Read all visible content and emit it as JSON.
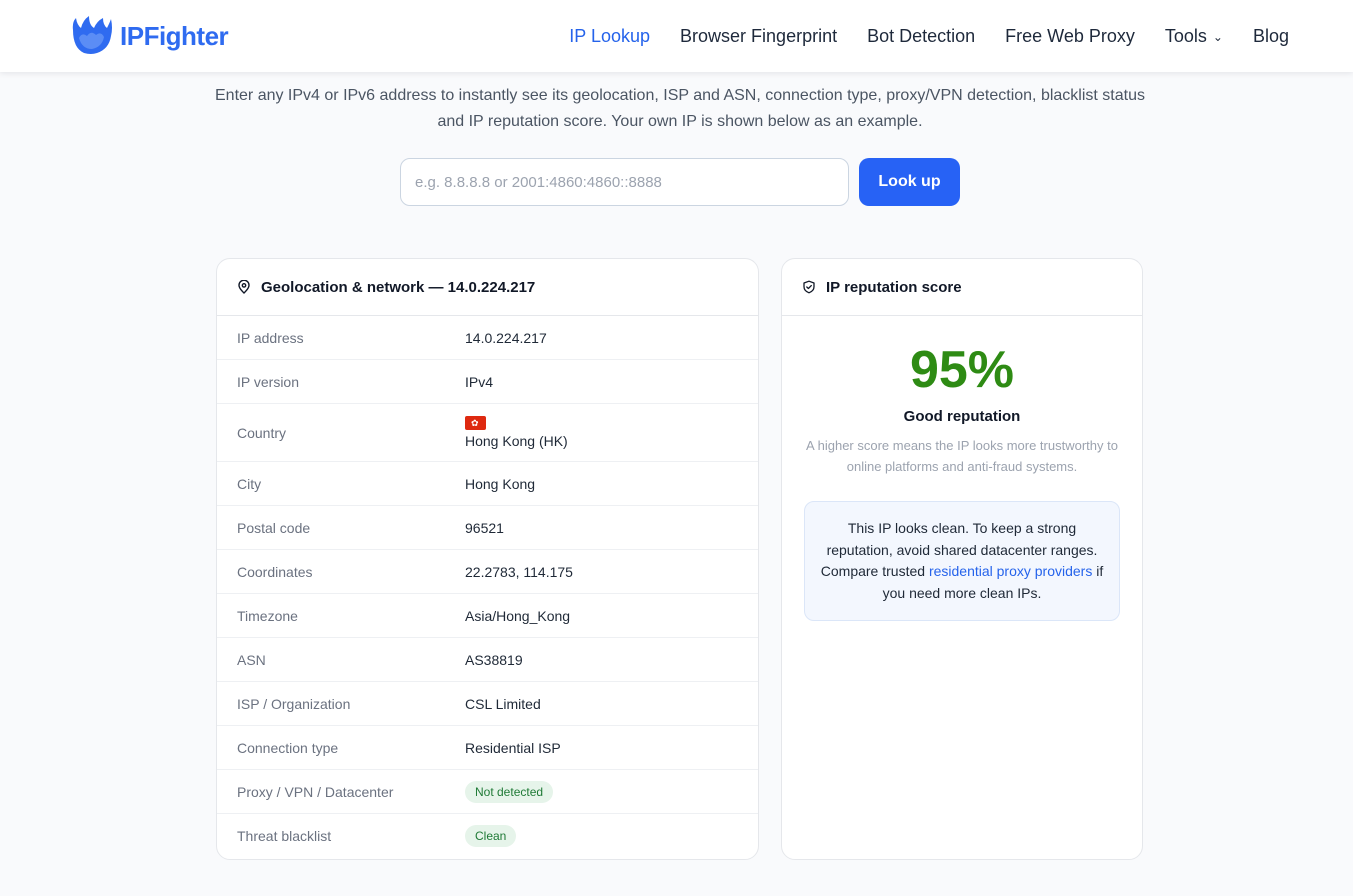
{
  "nav": {
    "brand": "IPFighter",
    "links": [
      {
        "label": "IP Lookup",
        "active": true
      },
      {
        "label": "Browser Fingerprint"
      },
      {
        "label": "Bot Detection"
      },
      {
        "label": "Free Web Proxy"
      },
      {
        "label": "Tools",
        "dropdown": true
      },
      {
        "label": "Blog"
      }
    ]
  },
  "hero": {
    "subtitle": "Enter any IPv4 or IPv6 address to instantly see its geolocation, ISP and ASN, connection type, proxy/VPN detection, blacklist status and IP reputation score. Your own IP is shown below as an example."
  },
  "search": {
    "placeholder": "e.g. 8.8.8.8 or 2001:4860:4860::8888",
    "value": "",
    "button_label": "Look up"
  },
  "geo_card": {
    "title": "Geolocation & network — 14.0.224.217",
    "rows": [
      {
        "key": "IP address",
        "value": "14.0.224.217"
      },
      {
        "key": "IP version",
        "value": "IPv4"
      },
      {
        "key": "Country",
        "value": "Hong Kong (HK)",
        "flag": "hk-flag-icon"
      },
      {
        "key": "City",
        "value": "Hong Kong"
      },
      {
        "key": "Postal code",
        "value": "96521"
      },
      {
        "key": "Coordinates",
        "value": "22.2783, 114.175"
      },
      {
        "key": "Timezone",
        "value": "Asia/Hong_Kong"
      },
      {
        "key": "ASN",
        "value": "AS38819"
      },
      {
        "key": "ISP / Organization",
        "value": "CSL Limited"
      },
      {
        "key": "Connection type",
        "value": "Residential ISP"
      },
      {
        "key": "Proxy / VPN / Datacenter",
        "value": "Not detected",
        "badge": true
      },
      {
        "key": "Threat blacklist",
        "value": "Clean",
        "badge": true
      }
    ]
  },
  "reputation": {
    "title": "IP reputation score",
    "score": "95%",
    "label": "Good reputation",
    "description": "A higher score means the IP looks more trustworthy to online platforms and anti-fraud systems.",
    "info_before": "This IP looks clean. To keep a strong reputation, avoid shared datacenter ranges. Compare trusted ",
    "info_link": "residential proxy providers",
    "info_after": " if you need more clean IPs."
  },
  "colors": {
    "accent": "#2563eb",
    "score_green": "#2e8b14",
    "badge_bg": "#e6f4ea",
    "badge_text": "#1f7a36"
  }
}
